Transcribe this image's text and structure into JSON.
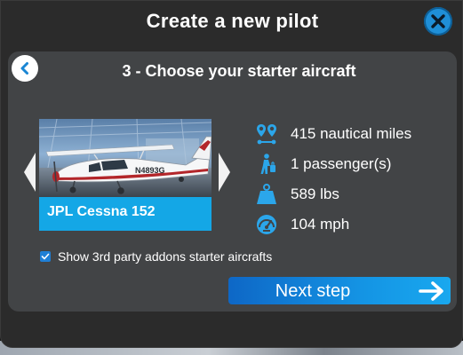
{
  "dialog": {
    "title": "Create a new pilot",
    "close_icon": "close-icon"
  },
  "step": {
    "title": "3 - Choose your starter aircraft",
    "back_icon": "chevron-left-icon"
  },
  "aircraft": {
    "name": "JPL Cessna 152",
    "registration": "N4893G",
    "photo_icon": "aircraft-photo"
  },
  "specs": [
    {
      "icon": "route-icon",
      "text": "415 nautical miles"
    },
    {
      "icon": "passenger-icon",
      "text": "1 passenger(s)"
    },
    {
      "icon": "weight-icon",
      "text": "589 lbs"
    },
    {
      "icon": "speedometer-icon",
      "text": "104 mph"
    }
  ],
  "options": {
    "show_3rd_party_label": "Show 3rd party addons starter aircrafts",
    "show_3rd_party_checked": true
  },
  "actions": {
    "next_label": "Next step",
    "next_icon": "arrow-right-icon"
  },
  "colors": {
    "accent": "#14a7e6",
    "icon": "#2ba6ea",
    "panel": "#424446",
    "dialog": "#2b2b2b"
  }
}
